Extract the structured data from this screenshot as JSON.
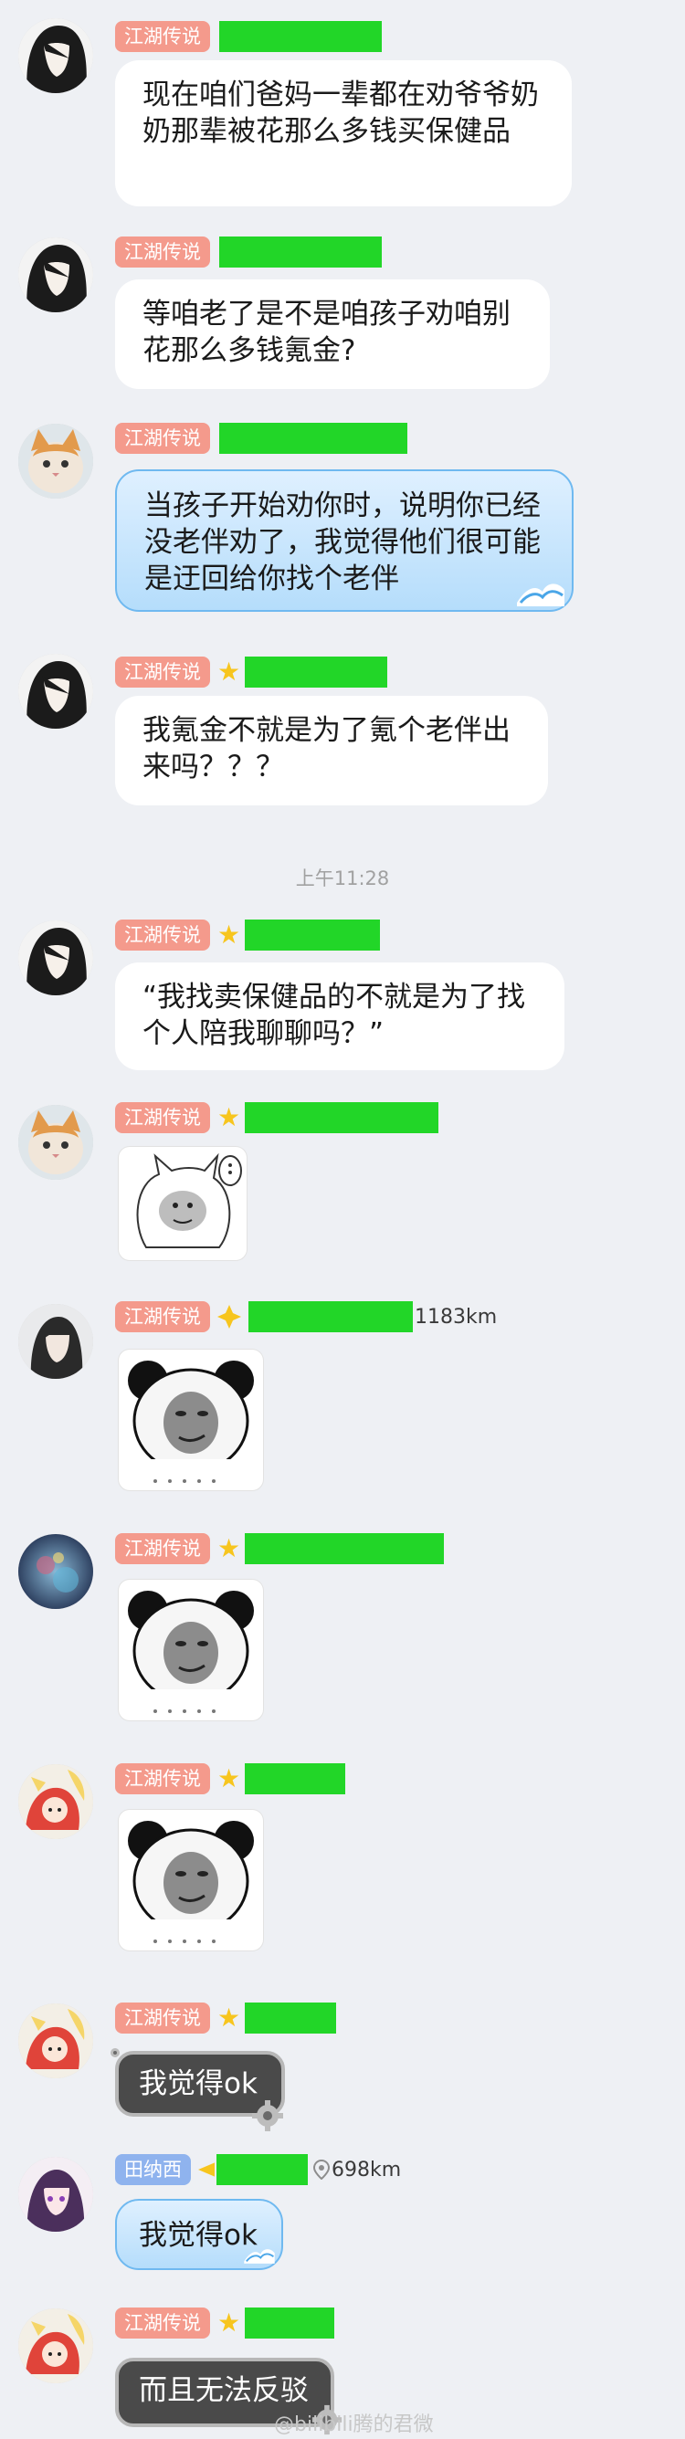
{
  "colors": {
    "background": "#eef0f4",
    "badge_red": "#f49a8c",
    "badge_blue": "#8fb3ee",
    "redaction": "#22d628",
    "bubble_blue": "#b5ddfb",
    "bubble_dark": "#4a4a4a"
  },
  "messages": [
    {
      "badge": "江湖传说",
      "text": "现在咱们爸妈一辈都在劝爷爷奶奶那辈被花那么多钱买保健品"
    },
    {
      "badge": "江湖传说",
      "text": "等咱老了是不是咱孩子劝咱别花那么多钱氪金?"
    },
    {
      "badge": "江湖传说",
      "text": "当孩子开始劝你时，说明你已经没老伴劝了，我觉得他们很可能是迂回给你找个老伴"
    },
    {
      "badge": "江湖传说",
      "text": "我氪金不就是为了氪个老伴出来吗？？？"
    },
    {
      "badge": "江湖传说",
      "text": "“我找卖保健品的不就是为了找个人陪我聊聊吗？”"
    },
    {
      "badge": "江湖传说",
      "sticker": "cat-sticker"
    },
    {
      "badge": "江湖传说",
      "distance": "1183km",
      "sticker": "panda-meme-sticker"
    },
    {
      "badge": "江湖传说",
      "sticker": "panda-meme-sticker"
    },
    {
      "badge": "江湖传说",
      "sticker": "panda-meme-sticker"
    },
    {
      "badge": "江湖传说",
      "text": "我觉得ok"
    },
    {
      "badge": "田纳西",
      "distance": "698km",
      "text": "我觉得ok"
    },
    {
      "badge": "江湖传说",
      "text": "而且无法反驳"
    }
  ],
  "timestamp": "上午11:28",
  "watermark": "@bilibili腾的君微"
}
